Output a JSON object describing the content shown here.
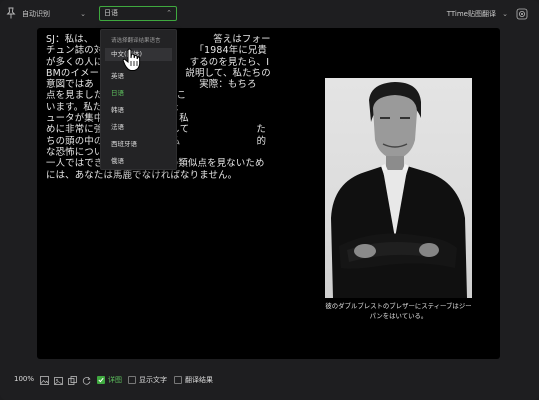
{
  "toolbar": {
    "source_lang": "自动识别",
    "target_lang": "日语",
    "engine": "TTime贴图翻译"
  },
  "dropdown": {
    "title": "请选择翻译结果语言",
    "items": [
      {
        "label": "中文(简体)",
        "state": "hover"
      },
      {
        "label": "英语",
        "state": "normal"
      },
      {
        "label": "日语",
        "state": "active"
      },
      {
        "label": "韩语",
        "state": "normal"
      },
      {
        "label": "法语",
        "state": "normal"
      },
      {
        "label": "西班牙语",
        "state": "normal"
      },
      {
        "label": "俄语",
        "state": "normal"
      }
    ]
  },
  "content": {
    "translated_text": "SJ：私は、　　　　　　　　　　　　　答えはフォーチュン誌の対　　　　　　　　　　「1984年に兄貴が多くの人に　　　　　　　　　するのを見たら、IBMのイメー　　　　　　　　　説明して、私たちの意図ではあ　　　　　　　　　　　実際：もちろ　　　　　　　　　点を見ました。私たちは2つのこ　　　　　　　　　　　　います。私たちが最初に言った　　　　　　　　　ュータが集中的な集団として、私　　　　　　　　　めに非常に強力な機械を制御して　　　　　　　たちの頭の中の象徴的な恐怖、私　　　　　　　　的な恐怖について コメントして　　　　　　　　　　一人ではできません。IBMとの類似点を見ないためには、あなたは馬鹿でなければなりません。",
    "caption": "彼のダブルブレストのブレザーにスティーブはジーパンをはいている。"
  },
  "bottombar": {
    "zoom": "100%",
    "detail_label": "详图",
    "show_text_label": "显示文字",
    "translate_result_label": "翻译结果",
    "detail_checked": true,
    "show_text_checked": false,
    "translate_result_checked": false
  },
  "colors": {
    "accent": "#3fa93f",
    "background": "#1e1e20",
    "panel": "#000000"
  },
  "icons": [
    "pin-icon",
    "chevron-down-icon",
    "gear-icon",
    "image-icon",
    "gallery-icon",
    "copy-icon",
    "refresh-icon",
    "pointer-hand-icon"
  ]
}
